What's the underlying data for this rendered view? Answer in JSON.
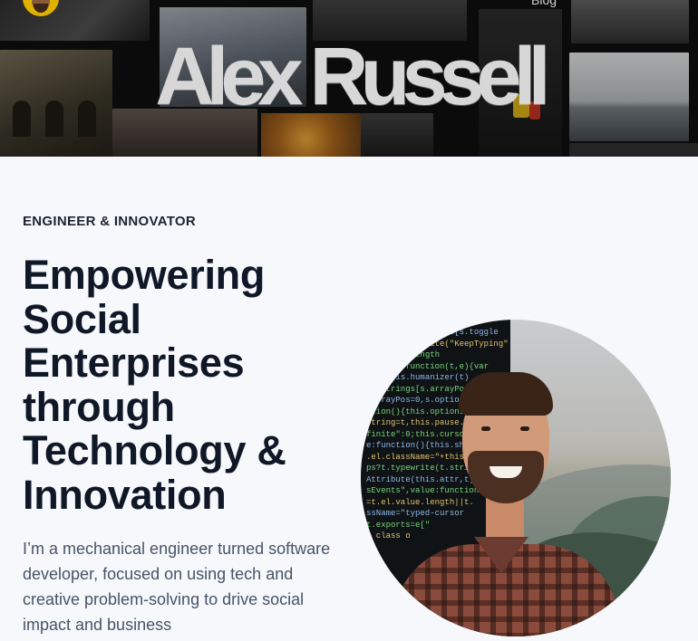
{
  "header": {
    "site_title": "Alex Russell",
    "nav": {
      "blog_label": "Blog"
    }
  },
  "hero_section": {
    "eyebrow": "ENGINEER & INNOVATOR",
    "headline_lines": [
      "Empowering",
      "Social",
      "Enterprises",
      "through",
      "Technology &",
      "Innovation"
    ],
    "bio": "I’m a mechanical engineer turned software developer, focused on using tech and creative problem-solving to drive social impact and business"
  },
  "icons": {
    "avatar": "avatar-icon"
  },
  "colors": {
    "page_background": "#f6f8fb",
    "headline": "#101828",
    "body_text": "#475467",
    "hero_background": "#0e0e0e"
  }
}
